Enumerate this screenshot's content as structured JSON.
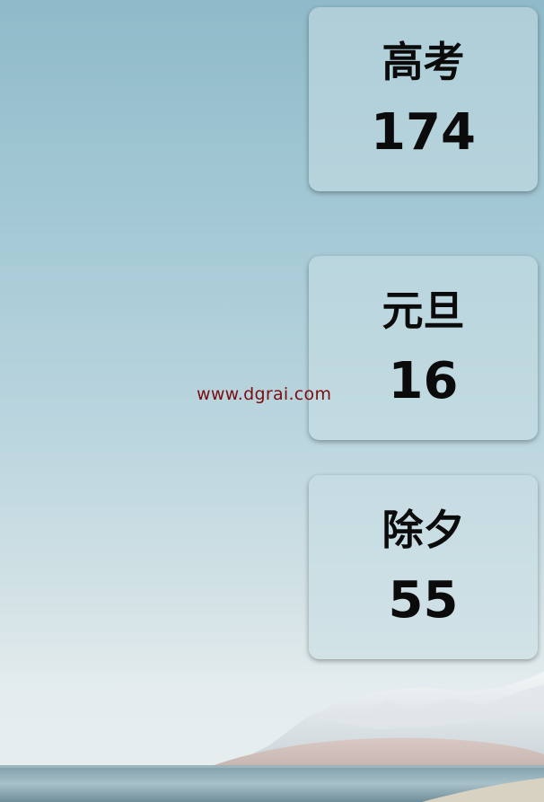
{
  "countdowns": [
    {
      "title": "高考",
      "days": "174"
    },
    {
      "title": "元旦",
      "days": "16"
    },
    {
      "title": "除夕",
      "days": "55"
    }
  ],
  "watermark": "www.dgrai.com",
  "colors": {
    "sky_top": "#8fbac9",
    "sky_bottom": "#e8eef0",
    "card_bg": "#c8dee4",
    "text": "#0b0b0b",
    "watermark": "#7a0d10"
  }
}
